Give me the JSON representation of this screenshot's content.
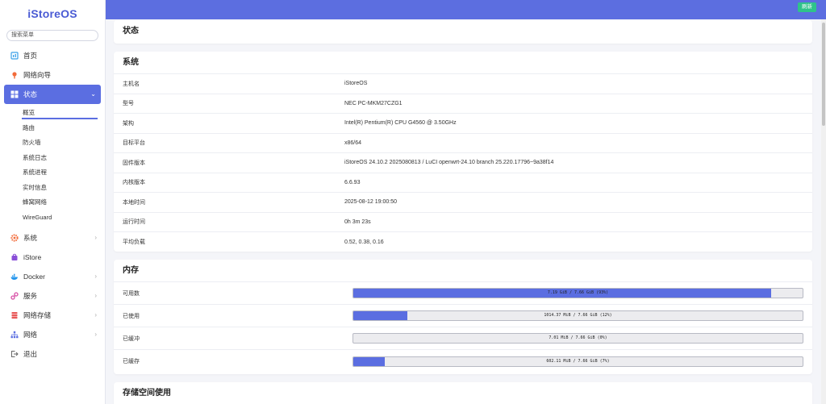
{
  "sidebar": {
    "logo": "iStoreOS",
    "search_placeholder": "搜索菜单",
    "items": [
      {
        "label": "首页",
        "icon": "home-icon"
      },
      {
        "label": "网络向导",
        "icon": "wizard-icon"
      },
      {
        "label": "状态",
        "icon": "status-grid-icon",
        "active": true,
        "children": [
          "概览",
          "路由",
          "防火墙",
          "系统日志",
          "系统进程",
          "实时信息",
          "蜂窝网络",
          "WireGuard"
        ]
      },
      {
        "label": "系统",
        "icon": "gear-icon"
      },
      {
        "label": "iStore",
        "icon": "store-icon"
      },
      {
        "label": "Docker",
        "icon": "docker-icon"
      },
      {
        "label": "服务",
        "icon": "services-icon"
      },
      {
        "label": "网络存储",
        "icon": "storage-icon"
      },
      {
        "label": "网络",
        "icon": "network-icon"
      },
      {
        "label": "退出",
        "icon": "logout-icon"
      }
    ]
  },
  "topbar": {
    "refresh_label": "刷新"
  },
  "page": {
    "title": "状态"
  },
  "system": {
    "title": "系统",
    "rows": [
      {
        "k": "主机名",
        "v": "iStoreOS"
      },
      {
        "k": "型号",
        "v": "NEC PC-MKM27CZG1"
      },
      {
        "k": "架构",
        "v": "Intel(R) Pentium(R) CPU G4560 @ 3.50GHz"
      },
      {
        "k": "目标平台",
        "v": "x86/64"
      },
      {
        "k": "固件版本",
        "v": "iStoreOS 24.10.2 2025080813 / LuCI openwrt-24.10 branch 25.220.17796~9a38f14"
      },
      {
        "k": "内核版本",
        "v": "6.6.93"
      },
      {
        "k": "本地时间",
        "v": "2025-08-12 19:00:50"
      },
      {
        "k": "运行时间",
        "v": "0h 3m 23s"
      },
      {
        "k": "平均负载",
        "v": "0.52, 0.38, 0.16"
      }
    ]
  },
  "memory": {
    "title": "内存",
    "rows": [
      {
        "k": "可用数",
        "text": "7.19 GiB / 7.66 GiB (93%)",
        "percent": 93
      },
      {
        "k": "已使用",
        "text": "1014.37 MiB / 7.66 GiB (12%)",
        "percent": 12
      },
      {
        "k": "已缓冲",
        "text": "7.01 MiB / 7.66 GiB (0%)",
        "percent": 0
      },
      {
        "k": "已缓存",
        "text": "602.11 MiB / 7.66 GiB (7%)",
        "percent": 7
      }
    ]
  },
  "storage": {
    "title": "存储空间使用"
  }
}
